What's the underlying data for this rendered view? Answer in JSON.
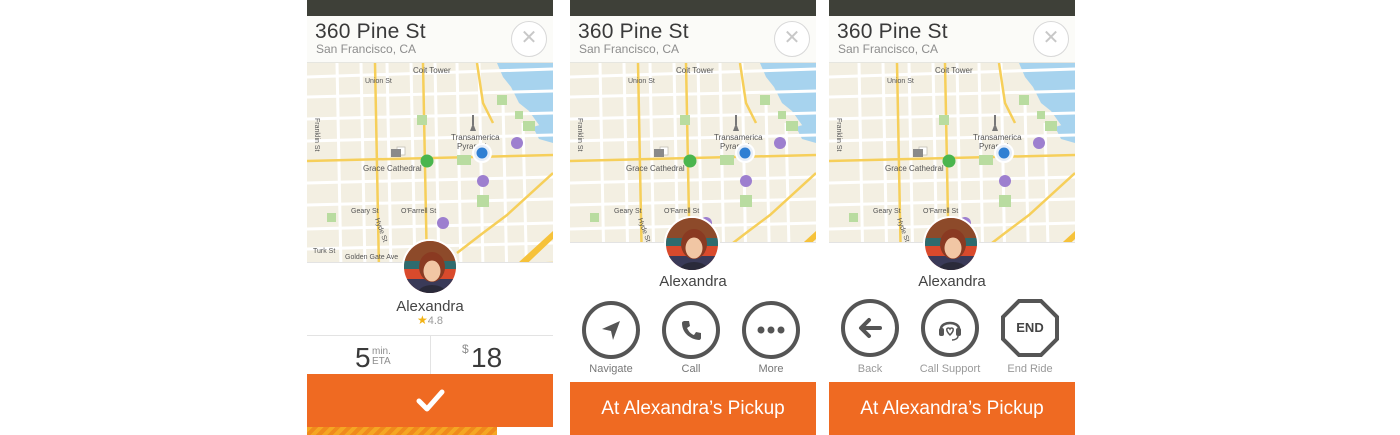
{
  "location": {
    "street": "360 Pine St",
    "city": "San Francisco, CA"
  },
  "map_labels": {
    "coit_tower": "Coit Tower",
    "union_st": "Union St",
    "franklin_st": "Franklin St",
    "transamerica": "Transamerica",
    "pyramid": "Pyramid",
    "grace_cathedral": "Grace Cathedral",
    "geary_st": "Geary St",
    "ofarrell_st": "O'Farrell St",
    "hyde_st": "Hyde St",
    "turk_st": "Turk St",
    "golden_gate_ave": "Golden Gate Ave"
  },
  "rider": {
    "name": "Alexandra",
    "rating": "4.8"
  },
  "screen1": {
    "eta_value": "5",
    "eta_unit": "min.",
    "eta_label": "ETA",
    "fare_currency": "$",
    "fare_value": "18"
  },
  "screen2": {
    "actions": [
      {
        "label": "Navigate",
        "icon": "navigate-arrow-icon"
      },
      {
        "label": "Call",
        "icon": "phone-icon"
      },
      {
        "label": "More",
        "icon": "more-dots-icon"
      }
    ],
    "cta": "At Alexandra’s Pickup"
  },
  "screen3": {
    "actions": [
      {
        "label": "Back",
        "icon": "back-arrow-icon"
      },
      {
        "label": "Call Support",
        "icon": "support-headset-icon"
      },
      {
        "label": "End Ride",
        "icon": "end-octagon-icon",
        "badge": "END"
      }
    ],
    "cta": "At Alexandra’s Pickup"
  },
  "colors": {
    "accent": "#ef6a22",
    "map_bg": "#f3efe2",
    "water": "#a7d3ee",
    "pickup_dot": "#4ab54e",
    "driver_dot": "#2f7fd3"
  },
  "icons": [
    "close-icon",
    "checkmark-icon",
    "star-icon",
    "train-station-icon",
    "landmark-icon"
  ]
}
